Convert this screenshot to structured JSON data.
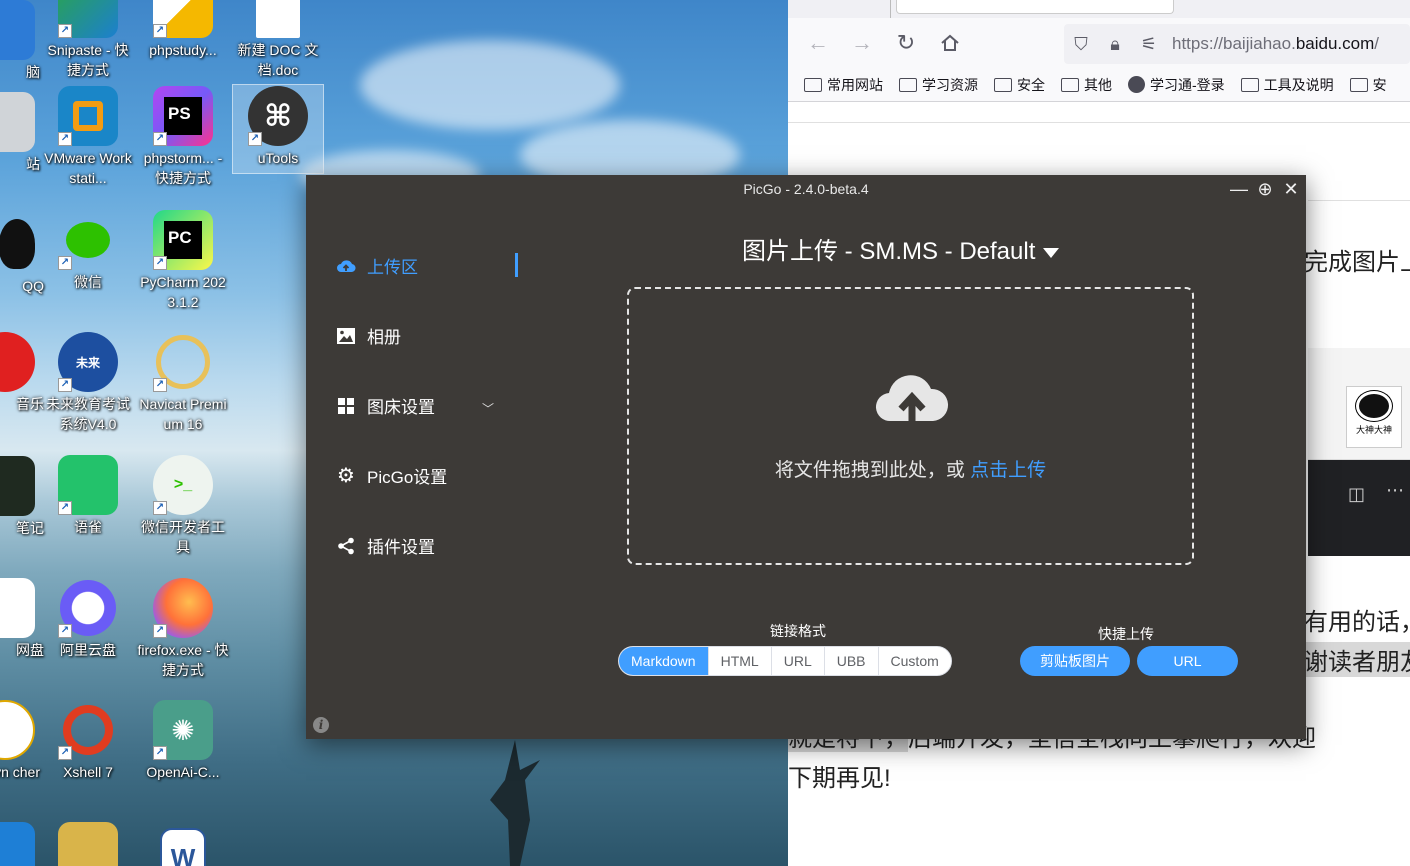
{
  "desktop": {
    "icons": [
      {
        "id": "computer",
        "label": "脑"
      },
      {
        "id": "snipaste",
        "label": "Snipaste - 快捷方式"
      },
      {
        "id": "phpstudy",
        "label": "phpstudy..."
      },
      {
        "id": "newdoc",
        "label": "新建 DOC 文档.doc"
      },
      {
        "id": "recycle",
        "label": "站"
      },
      {
        "id": "vmware",
        "label": "VMware Workstati..."
      },
      {
        "id": "phpstorm",
        "label": "phpstorm... - 快捷方式"
      },
      {
        "id": "utools",
        "label": "uTools"
      },
      {
        "id": "qq",
        "label": "QQ"
      },
      {
        "id": "wechat",
        "label": "微信"
      },
      {
        "id": "pycharm",
        "label": "PyCharm 2023.1.2"
      },
      {
        "id": "music",
        "label": "音乐"
      },
      {
        "id": "future",
        "label": "未来教育考试系统V4.0"
      },
      {
        "id": "navicat",
        "label": "Navicat Premium 16"
      },
      {
        "id": "notes",
        "label": "笔记"
      },
      {
        "id": "yuque",
        "label": "语雀"
      },
      {
        "id": "wechatdev",
        "label": "微信开发者工具"
      },
      {
        "id": "netdisk",
        "label": "网盘"
      },
      {
        "id": "aliyun",
        "label": "阿里云盘"
      },
      {
        "id": "firefox",
        "label": "firefox.exe - 快捷方式"
      },
      {
        "id": "launcher",
        "label": "vn cher"
      },
      {
        "id": "xshell",
        "label": "Xshell 7"
      },
      {
        "id": "openai",
        "label": "OpenAi-C..."
      }
    ]
  },
  "browser": {
    "url_prefix": "https://baijiahao.",
    "url_domain": "baidu.com",
    "url_suffix": "/",
    "bookmarks": [
      "常用网站",
      "学习资源",
      "安全",
      "其他",
      "学习通-登录",
      "工具及说明",
      "安"
    ],
    "page": {
      "text1": "完成图片上",
      "text2": "有用的话，",
      "text3": "谢读者朋友",
      "text4": "就是将下，",
      "text5": "后端开发，坚信全栈向上攀爬行，欢迎",
      "text6": "下期再见!",
      "meme_caption": "大神大神"
    }
  },
  "picgo": {
    "title": "PicGo - 2.4.0-beta.4",
    "sidebar": {
      "upload": "上传区",
      "album": "相册",
      "picbed": "图床设置",
      "settings": "PicGo设置",
      "plugins": "插件设置"
    },
    "main_title": "图片上传 - SM.MS - Default",
    "drop_hint": "将文件拖拽到此处，或 ",
    "drop_link": "点击上传",
    "link_format_label": "链接格式",
    "formats": [
      "Markdown",
      "HTML",
      "URL",
      "UBB",
      "Custom"
    ],
    "selected_format": "Markdown",
    "quick_label": "快捷上传",
    "quick_clipboard": "剪贴板图片",
    "quick_url": "URL",
    "accent": "#409eff"
  }
}
